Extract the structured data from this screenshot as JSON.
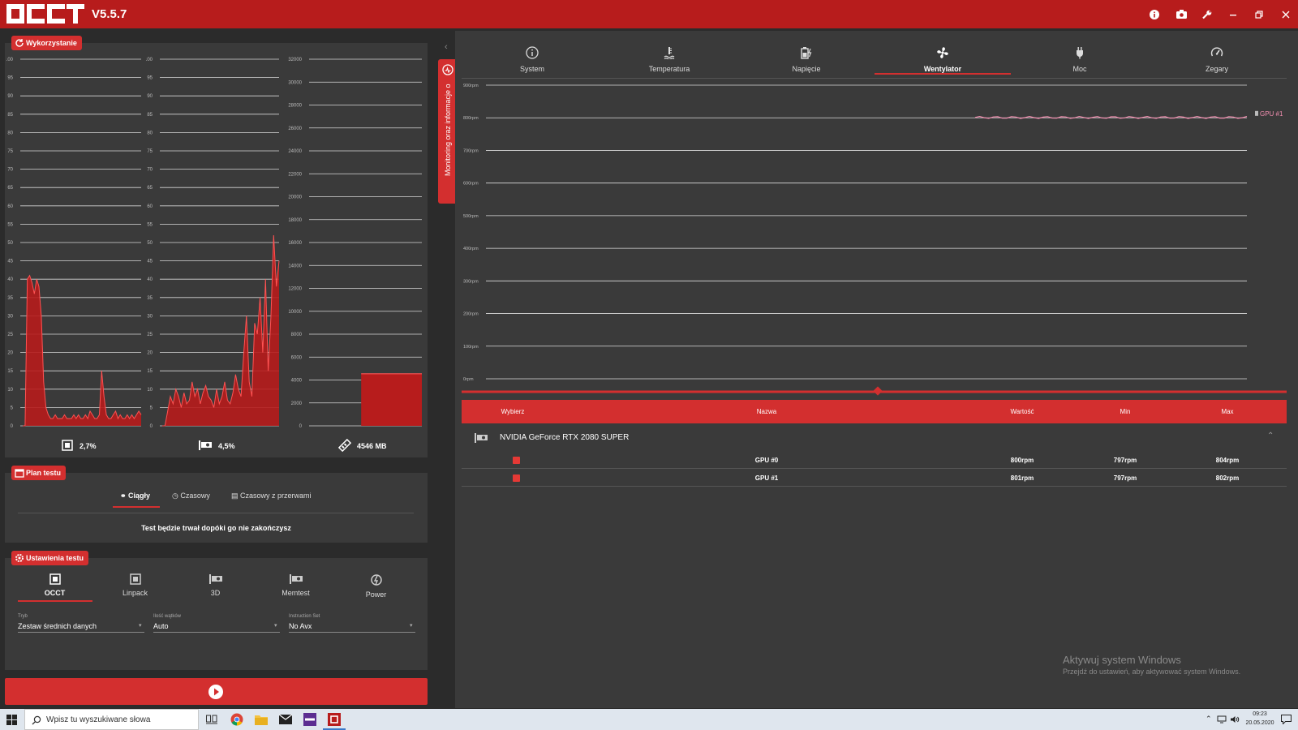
{
  "app": {
    "version": "V5.5.7"
  },
  "usage": {
    "label": "Wykorzystanie",
    "cpu_ticks": [
      "100",
      "95",
      "90",
      "85",
      "80",
      "75",
      "70",
      "65",
      "60",
      "55",
      "50",
      "45",
      "40",
      "35",
      "30",
      "25",
      "20",
      "15",
      "10",
      "5",
      "0"
    ],
    "gpu_ticks": [
      "100",
      "95",
      "90",
      "85",
      "80",
      "75",
      "70",
      "65",
      "60",
      "55",
      "50",
      "45",
      "40",
      "35",
      "30",
      "25",
      "20",
      "15",
      "10",
      "5",
      "0"
    ],
    "mem_ticks": [
      "32000",
      "30000",
      "28000",
      "26000",
      "24000",
      "22000",
      "20000",
      "18000",
      "16000",
      "14000",
      "12000",
      "10000",
      "8000",
      "6000",
      "4000",
      "2000",
      "0"
    ],
    "cpu_value": "2,7%",
    "gpu_value": "4,5%",
    "mem_value": "4546 MB",
    "cpu_series": [
      0,
      0,
      40,
      41,
      39,
      36,
      40,
      38,
      30,
      12,
      5,
      3,
      2,
      2,
      3,
      2,
      2,
      2,
      3,
      2,
      2,
      2,
      3,
      2,
      3,
      2,
      2,
      3,
      2,
      4,
      3,
      2,
      2,
      3,
      15,
      8,
      3,
      2,
      2,
      3,
      4,
      2,
      3,
      2,
      2,
      3,
      2,
      3,
      2,
      3,
      4,
      3
    ],
    "gpu_series": [
      0,
      0,
      4,
      8,
      6,
      10,
      8,
      5,
      9,
      6,
      7,
      12,
      8,
      10,
      6,
      9,
      11,
      8,
      7,
      5,
      10,
      6,
      8,
      12,
      7,
      6,
      9,
      14,
      10,
      8,
      20,
      30,
      12,
      8,
      28,
      25,
      35,
      20,
      40,
      15,
      30,
      52,
      38,
      45
    ],
    "mem_level": 4546,
    "mem_max": 32000
  },
  "plan": {
    "label": "Plan testu",
    "modes": [
      "Ciągły",
      "Czasowy",
      "Czasowy z przerwami"
    ],
    "description": "Test będzie trwał dopóki go nie zakończysz"
  },
  "settings": {
    "label": "Ustawienia testu",
    "tests": [
      "OCCT",
      "Linpack",
      "3D",
      "Memtest",
      "Power"
    ],
    "fields": [
      {
        "label": "Tryb",
        "value": "Zestaw średnich danych"
      },
      {
        "label": "Ilość wątków",
        "value": "Auto"
      },
      {
        "label": "Instruction Set",
        "value": "No Avx"
      }
    ]
  },
  "side_tab": "Monitoring oraz informacje o systemie",
  "monitor": {
    "tabs": [
      "System",
      "Temperatura",
      "Napięcie",
      "Wentylator",
      "Moc",
      "Zegary"
    ],
    "active_tab": "Wentylator",
    "y_ticks": [
      "900rpm",
      "800rpm",
      "700rpm",
      "600rpm",
      "500rpm",
      "400rpm",
      "300rpm",
      "200rpm",
      "100rpm",
      "0rpm"
    ],
    "series_label": "GPU #1",
    "series_value": 801,
    "y_max": 900
  },
  "table": {
    "headers": {
      "select": "Wybierz",
      "name": "Nazwa",
      "value": "Wartość",
      "min": "Min",
      "max": "Max"
    },
    "group": "NVIDIA GeForce RTX 2080 SUPER",
    "rows": [
      {
        "name": "GPU #0",
        "value": "800rpm",
        "min": "797rpm",
        "max": "804rpm"
      },
      {
        "name": "GPU #1",
        "value": "801rpm",
        "min": "797rpm",
        "max": "802rpm"
      }
    ]
  },
  "watermark": {
    "title": "Aktywuj system Windows",
    "subtitle": "Przejdź do ustawień, aby aktywować system Windows."
  },
  "taskbar": {
    "search_placeholder": "Wpisz tu wyszukiwane słowa",
    "time": "09:23",
    "date": "20.05.2020"
  },
  "colors": {
    "accent": "#d32f2f",
    "titlebar": "#b71c1c",
    "panel": "#3a3a3a",
    "bg": "#2b2b2b"
  }
}
